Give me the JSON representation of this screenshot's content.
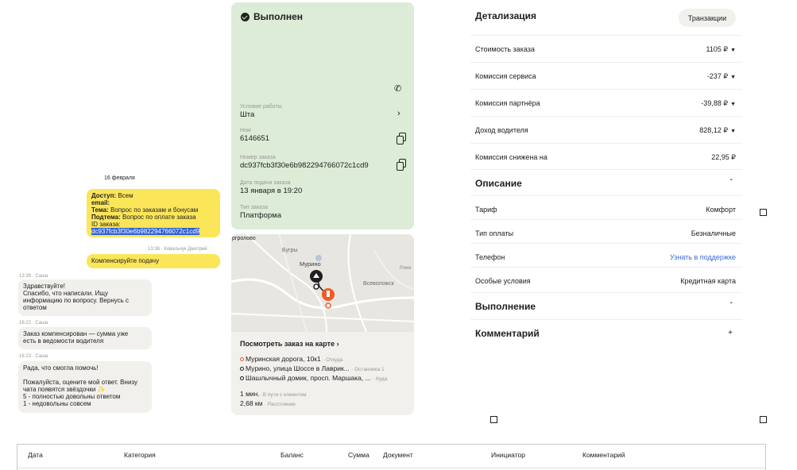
{
  "chat": {
    "date": "16 февраля",
    "msg1": {
      "dostup_label": "Доступ:",
      "dostup_value": "Всем",
      "email_label": "email:",
      "tema_label": "Тема:",
      "tema_value": "Вопрос по заказам и бонусам",
      "podtema_label": "Подтема:",
      "podtema_value": "Вопрос по оплате заказа",
      "id_label": "ID заказа:",
      "id_value": "dc937fcb3f30e6b982294766072c1cd9"
    },
    "msg2_meta": "13:38 · Ковальчук Дмитрий",
    "msg2": "Компенсируйте подачу",
    "msg3_meta": "13:39 · Саша",
    "msg3": [
      "Здравствуйте!",
      "Спасибо, что написали. Ищу",
      "информацию по вопросу. Вернусь с",
      "ответом"
    ],
    "msg4_meta": "16:22 · Саша",
    "msg4": [
      "Заказ компенсирован — сумма уже",
      "есть в ведомости водителя"
    ],
    "msg5_meta": "16:23 · Саша",
    "msg5": [
      "Рада, что смогла помочь!",
      "",
      "Пожалуйста, оцените мой ответ. Внизу",
      "чата появятся звёздочки ✨",
      "5 - полностью довольны ответом",
      "1 - недовольны совсем"
    ]
  },
  "order": {
    "status": "Выполнен",
    "conditions_label": "Условие работы",
    "conditions_value": "Шта",
    "nomer_label": "Ном",
    "nomer_value": "6146651",
    "order_number_label": "Номер заказа",
    "order_number_value": "dc937fcb3f30e6b982294766072c1cd9",
    "date_label": "Дата подачи заказа",
    "date_value": "13 января в 19:20",
    "type_label": "Тип заказа",
    "type_value": "Платформа"
  },
  "map": {
    "labels": [
      "ргролово",
      "Бугры",
      "Мурино",
      "Всеволожск",
      "Роме"
    ],
    "link": "Посмотреть заказ на карте",
    "route": [
      {
        "name": "Муринская дорога, 10к1",
        "sub": "· Откуда"
      },
      {
        "name": "Мурино, улица Шоссе в Лаврик...",
        "sub": "· Остановка 1"
      },
      {
        "name": "Шашлычный домик, просп. Маршака, ...",
        "sub": "· Куда"
      }
    ],
    "eta1_value": "1 мин.",
    "eta1_sub": "· В пути с клиентом",
    "eta2_value": "2,68 км",
    "eta2_sub": "· Расстояние"
  },
  "details": {
    "title": "Детализация",
    "tx_button": "Транзакции",
    "rows": [
      {
        "k": "Стоимость заказа",
        "v": "1105 ₽"
      },
      {
        "k": "Комиссия сервиса",
        "v": "-237 ₽"
      },
      {
        "k": "Комиссия партнёра",
        "v": "-39,88 ₽"
      },
      {
        "k": "Доход водителя",
        "v": "828,12 ₽"
      },
      {
        "k": "Комиссия снижена на",
        "v": "22,95 ₽"
      }
    ],
    "description_title": "Описание",
    "desc_rows": [
      {
        "k": "Тариф",
        "v": "Комфорт"
      },
      {
        "k": "Тип оплаты",
        "v": "Безналичные"
      },
      {
        "k": "Телефон",
        "v": "Узнать в поддержке"
      },
      {
        "k": "Особые условия",
        "v": "Кредитная карта"
      }
    ],
    "execution_title": "Выполнение",
    "comment_title": "Комментарий",
    "link_color": "#3f6bd8"
  },
  "table": {
    "headers": [
      "Дата",
      "Категория",
      "Баланс",
      "Сумма",
      "Документ",
      "Инициатор",
      "Комментарий"
    ]
  },
  "colors": {
    "bubble_out": "#fbe65a",
    "bubble_in": "#f1f0ed",
    "order_card": "#dcecd7",
    "route_marker": "#f05a28"
  }
}
